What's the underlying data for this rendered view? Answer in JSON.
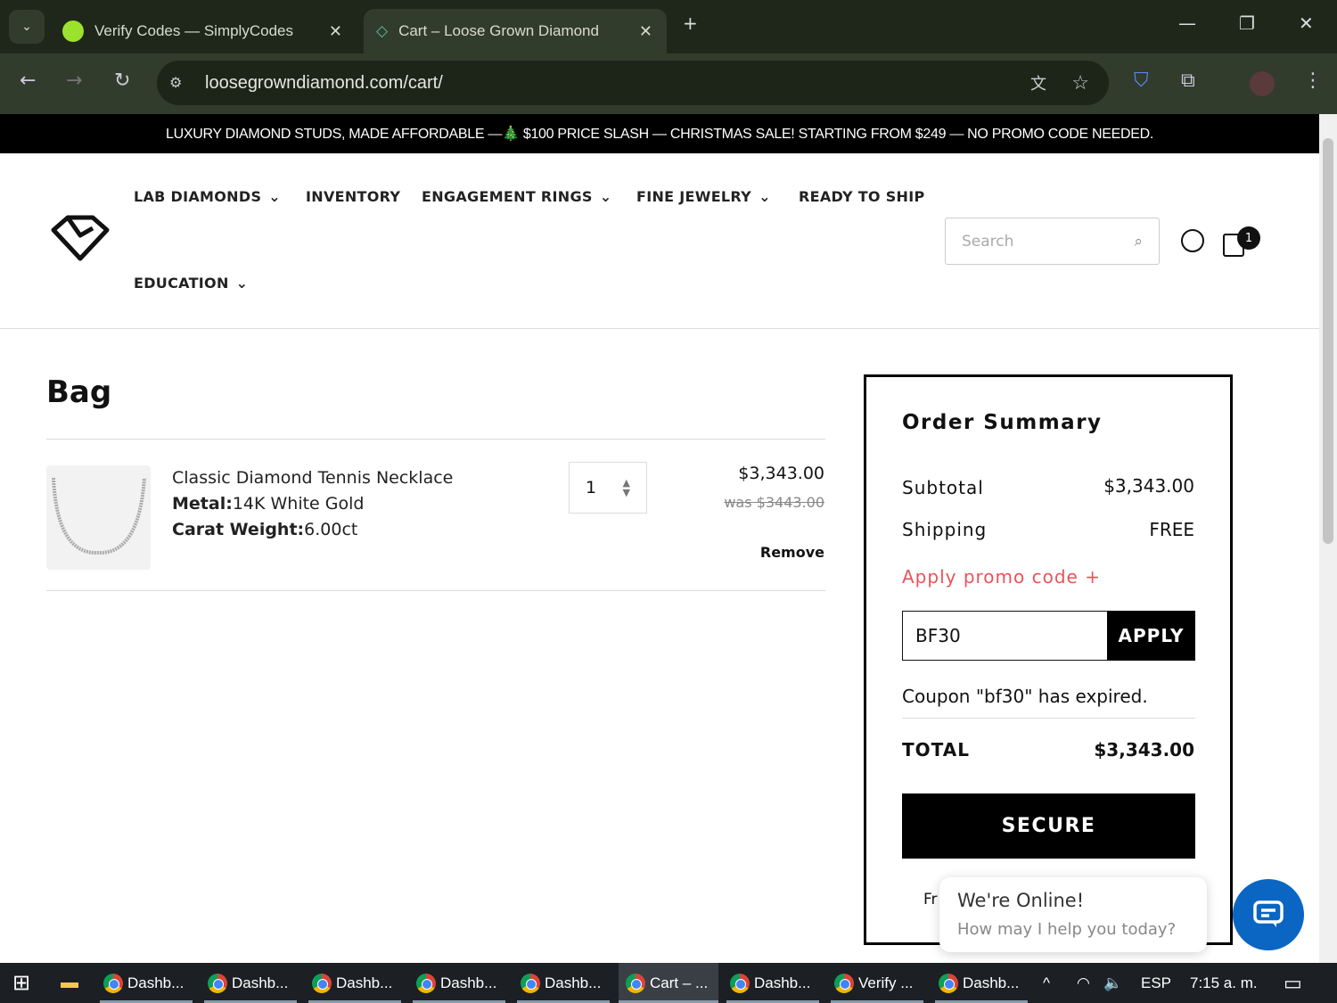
{
  "browser": {
    "tabs": [
      {
        "title": "Verify Codes — SimplyCodes",
        "active": false
      },
      {
        "title": "Cart – Loose Grown Diamond",
        "active": true
      }
    ],
    "url": "loosegrowndiamond.com/cart/"
  },
  "promo_banner": "LUXURY DIAMOND STUDS, MADE AFFORDABLE —🎄 $100 PRICE SLASH — CHRISTMAS SALE! STARTING FROM $249 — NO PROMO CODE NEEDED.",
  "nav": {
    "items": [
      "LAB DIAMONDS",
      "INVENTORY",
      "ENGAGEMENT RINGS",
      "FINE JEWELRY",
      "READY TO SHIP",
      "EDUCATION"
    ],
    "search_placeholder": "Search",
    "cart_count": "1"
  },
  "bag": {
    "title": "Bag",
    "item": {
      "name": "Classic Diamond Tennis Necklace",
      "metal_label": "Metal:",
      "metal": "14K White Gold",
      "carat_label": "Carat Weight:",
      "carat": "6.00ct",
      "quantity": "1",
      "price": "$3,343.00",
      "was_price": "was $3443.00",
      "remove": "Remove"
    }
  },
  "summary": {
    "title": "Order Summary",
    "subtotal_label": "Subtotal",
    "subtotal": "$3,343.00",
    "shipping_label": "Shipping",
    "shipping": "FREE",
    "promo_link": "Apply promo code +",
    "promo_value": "BF30",
    "apply": "APPLY",
    "coupon_msg": "Coupon \"bf30\" has expired.",
    "total_label": "TOTAL",
    "total": "$3,343.00",
    "secure": "SECURE",
    "partial": "Fr"
  },
  "chat": {
    "title": "We're Online!",
    "subtitle": "How may I help you today?"
  },
  "taskbar": {
    "items": [
      "Dashb...",
      "Dashb...",
      "Dashb...",
      "Dashb...",
      "Dashb...",
      "Cart – ...",
      "Dashb...",
      "Verify ...",
      "Dashb..."
    ],
    "lang": "ESP",
    "time": "7:15 a. m."
  },
  "colors": {
    "accent_red": "#e8545a",
    "chat_blue": "#0a66c2"
  }
}
